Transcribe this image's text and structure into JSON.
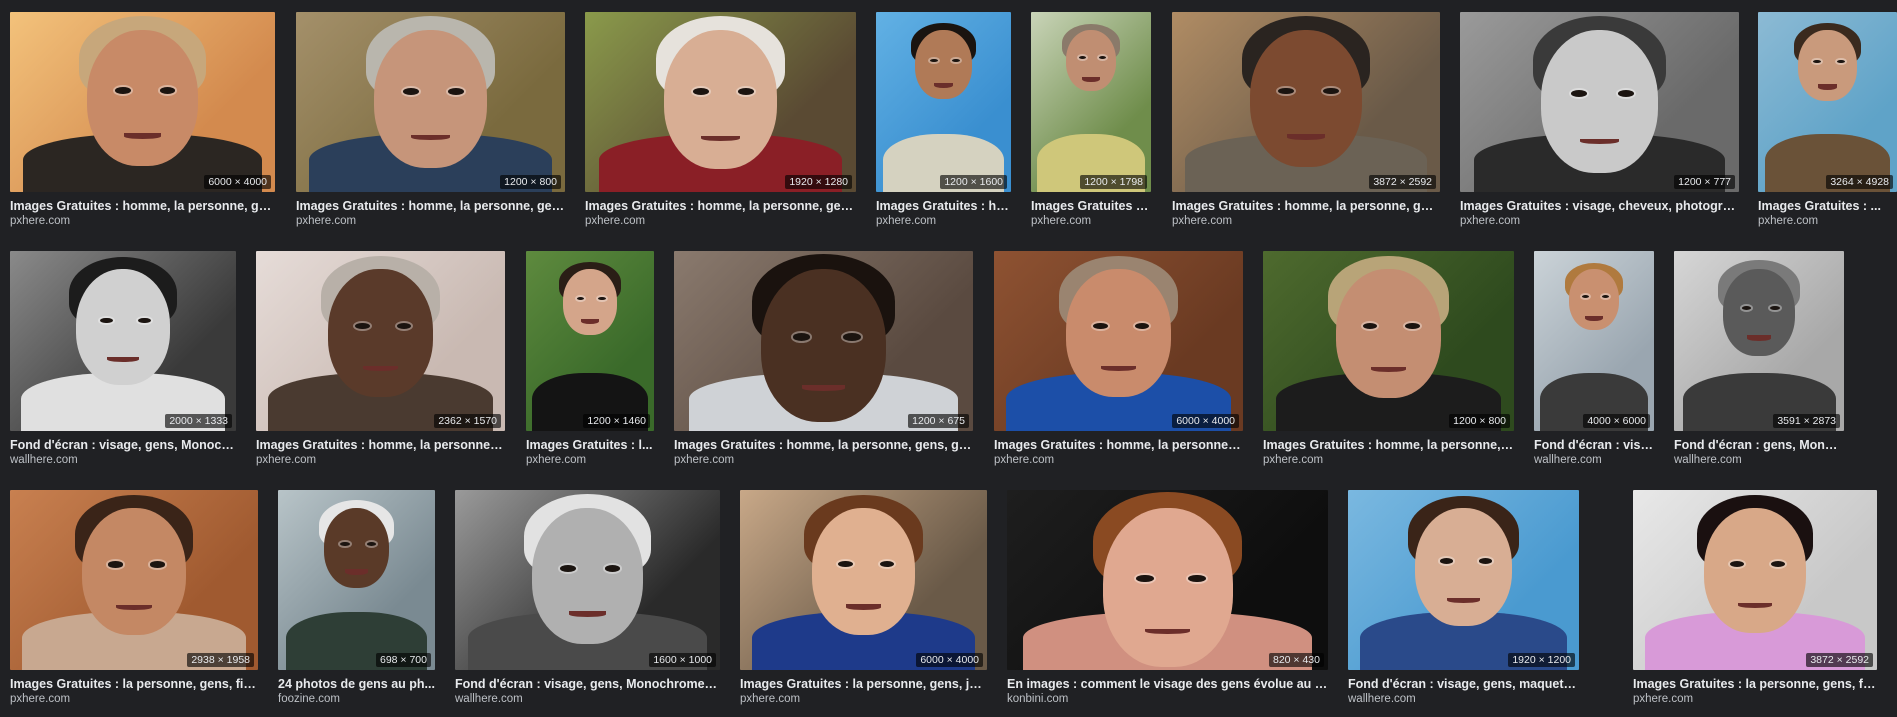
{
  "results": [
    {
      "dims": "6000 × 4000",
      "title": "Images Gratuites : homme, la personne, ge...",
      "source": "pxhere.com",
      "colors": {
        "bg": "#d38a4e",
        "bg2": "#f3c27b",
        "skin": "#c88a67",
        "hair": "#c7a77b",
        "body": "#2b2622"
      }
    },
    {
      "dims": "1200 × 800",
      "title": "Images Gratuites : homme, la personne, gen...",
      "source": "pxhere.com",
      "colors": {
        "bg": "#7a6a3e",
        "bg2": "#a4906a",
        "skin": "#c6957a",
        "hair": "#b9b6ad",
        "body": "#2b3f5a"
      }
    },
    {
      "dims": "1920 × 1280",
      "title": "Images Gratuites : homme, la personne, gen...",
      "source": "pxhere.com",
      "colors": {
        "bg": "#5a4a33",
        "bg2": "#8a9a4b",
        "skin": "#d8ae94",
        "hair": "#e6e2dc",
        "body": "#8a1f26"
      }
    },
    {
      "dims": "1200 × 1600",
      "title": "Images Gratuites : ho...",
      "source": "pxhere.com",
      "colors": {
        "bg": "#3a8fd0",
        "bg2": "#62b1e4",
        "skin": "#b07a57",
        "hair": "#1a1410",
        "body": "#d5d2c0"
      }
    },
    {
      "dims": "1200 × 1798",
      "title": "Images Gratuites : ...",
      "source": "pxhere.com",
      "colors": {
        "bg": "#6f8d4b",
        "bg2": "#c9d4b8",
        "skin": "#c08e72",
        "hair": "#8a7a6a",
        "body": "#cfc77a"
      }
    },
    {
      "dims": "3872 × 2592",
      "title": "Images Gratuites : homme, la personne, gen...",
      "source": "pxhere.com",
      "colors": {
        "bg": "#6a5a48",
        "bg2": "#b08c64",
        "skin": "#7c4a30",
        "hair": "#2a2420",
        "body": "#6b6255"
      }
    },
    {
      "dims": "1200 × 777",
      "title": "Images Gratuites : visage, cheveux, photogra...",
      "source": "pxhere.com",
      "colors": {
        "bg": "#6a6a6a",
        "bg2": "#9a9a9a",
        "skin": "#c9c9c9",
        "hair": "#3a3a3a",
        "body": "#2a2a2a"
      }
    },
    {
      "dims": "3264 × 4928",
      "title": "Images Gratuites : ...",
      "source": "pxhere.com",
      "colors": {
        "bg": "#5fa3c8",
        "bg2": "#8cbad4",
        "skin": "#c99a7c",
        "hair": "#3a2a1e",
        "body": "#6a5238"
      }
    },
    {
      "dims": "2000 × 1333",
      "title": "Fond d'écran : visage, gens, Monoch...",
      "source": "wallhere.com",
      "colors": {
        "bg": "#3a3a3a",
        "bg2": "#8a8a8a",
        "skin": "#d0d0d0",
        "hair": "#1c1c1c",
        "body": "#e0e0e0"
      }
    },
    {
      "dims": "2362 × 1570",
      "title": "Images Gratuites : homme, la personne, ...",
      "source": "pxhere.com",
      "colors": {
        "bg": "#c9b9b2",
        "bg2": "#e6dcd8",
        "skin": "#5a3a2a",
        "hair": "#b8b0a8",
        "body": "#4a3a30"
      }
    },
    {
      "dims": "1200 × 1460",
      "title": "Images Gratuites : l...",
      "source": "pxhere.com",
      "colors": {
        "bg": "#3a6a2a",
        "bg2": "#5e8a3e",
        "skin": "#d4a58a",
        "hair": "#2a1e16",
        "body": "#141414"
      }
    },
    {
      "dims": "1200 × 675",
      "title": "Images Gratuites : homme, la personne, gens, ga...",
      "source": "pxhere.com",
      "colors": {
        "bg": "#5a4a40",
        "bg2": "#8a7a6e",
        "skin": "#4a3022",
        "hair": "#1a120e",
        "body": "#cfd2d6"
      }
    },
    {
      "dims": "6000 × 4000",
      "title": "Images Gratuites : homme, la personne, ...",
      "source": "pxhere.com",
      "colors": {
        "bg": "#6a3a22",
        "bg2": "#8e5232",
        "skin": "#c98b6c",
        "hair": "#9a8470",
        "body": "#1c4fa8"
      }
    },
    {
      "dims": "1200 × 800",
      "title": "Images Gratuites : homme, la personne, ...",
      "source": "pxhere.com",
      "colors": {
        "bg": "#2e4a1e",
        "bg2": "#4e6a2e",
        "skin": "#c48e72",
        "hair": "#b8a478",
        "body": "#1c1c1c"
      }
    },
    {
      "dims": "4000 × 6000",
      "title": "Fond d'écran : visa...",
      "source": "wallhere.com",
      "colors": {
        "bg": "#9aa6b0",
        "bg2": "#cbd3d8",
        "skin": "#c99070",
        "hair": "#b07a3e",
        "body": "#3a3a3a"
      }
    },
    {
      "dims": "3591 × 2873",
      "title": "Fond d'écran : gens, Monochrom...",
      "source": "wallhere.com",
      "colors": {
        "bg": "#a8a8a8",
        "bg2": "#d6d6d6",
        "skin": "#5a5a5a",
        "hair": "#7a7a7a",
        "body": "#3a3a3a"
      }
    },
    {
      "dims": "2938 × 1958",
      "title": "Images Gratuites : la personne, gens, fill...",
      "source": "pxhere.com",
      "colors": {
        "bg": "#a05a30",
        "bg2": "#c88050",
        "skin": "#c48864",
        "hair": "#3a2418",
        "body": "#c8a890"
      }
    },
    {
      "dims": "698 × 700",
      "title": "24 photos de gens au ph...",
      "source": "foozine.com",
      "colors": {
        "bg": "#7a8a92",
        "bg2": "#b8c4c8",
        "skin": "#5a3a28",
        "hair": "#e6e6e6",
        "body": "#2e3e36"
      }
    },
    {
      "dims": "1600 × 1000",
      "title": "Fond d'écran : visage, gens, Monochrome, l...",
      "source": "wallhere.com",
      "colors": {
        "bg": "#2a2a2a",
        "bg2": "#9a9a9a",
        "skin": "#b0b0b0",
        "hair": "#e2e2e2",
        "body": "#4a4a4a"
      }
    },
    {
      "dims": "6000 × 4000",
      "title": "Images Gratuites : la personne, gens, jo...",
      "source": "pxhere.com",
      "colors": {
        "bg": "#6a5a48",
        "bg2": "#c8a888",
        "skin": "#e0b090",
        "hair": "#6a3a1e",
        "body": "#1e3a8a"
      }
    },
    {
      "dims": "820 × 430",
      "title": "En images : comment le visage des gens évolue au fi...",
      "source": "konbini.com",
      "colors": {
        "bg": "#0e0e0e",
        "bg2": "#1e1e1e",
        "skin": "#e0a890",
        "hair": "#8a4a22",
        "body": "#d09080"
      }
    },
    {
      "dims": "1920 × 1200",
      "title": "Fond d'écran : visage, gens, maquette, la p...",
      "source": "wallhere.com",
      "colors": {
        "bg": "#4a9ad0",
        "bg2": "#7ab8e0",
        "skin": "#d8ae94",
        "hair": "#3a2418",
        "body": "#2a4a8a"
      }
    },
    {
      "dims": "3872 × 2592",
      "title": "Images Gratuites : la personne, gens, fill...",
      "source": "pxhere.com",
      "colors": {
        "bg": "#c8c8c8",
        "bg2": "#e8e8e8",
        "skin": "#d8a888",
        "hair": "#1a1010",
        "body": "#d89ad8"
      }
    }
  ]
}
